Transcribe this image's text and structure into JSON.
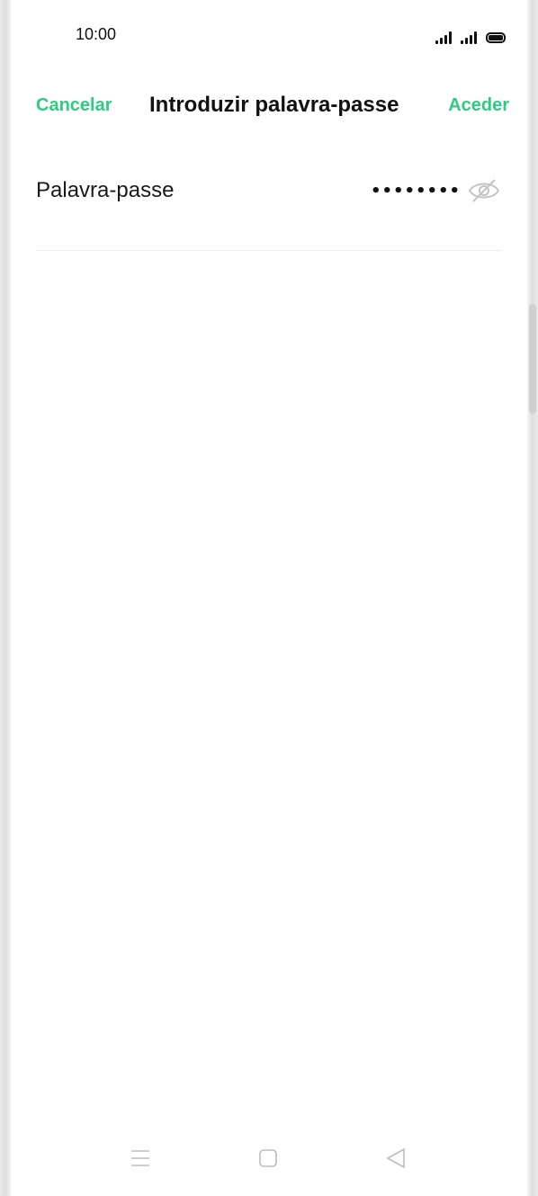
{
  "status_bar": {
    "time": "10:00",
    "icons": [
      "signal-icon",
      "signal-icon",
      "battery-icon"
    ]
  },
  "header": {
    "cancel_label": "Cancelar",
    "title": "Introduzir palavra-passe",
    "confirm_label": "Aceder"
  },
  "password_field": {
    "label": "Palavra-passe",
    "value": "••••••••",
    "visibility_icon": "eye-off-icon"
  },
  "nav_bar": {
    "icons": [
      "menu-icon",
      "home-icon",
      "back-icon"
    ]
  },
  "colors": {
    "accent": "#2ECC80",
    "text": "#111111",
    "divider": "#ECECEC",
    "icon_muted": "#BDBDBD"
  }
}
